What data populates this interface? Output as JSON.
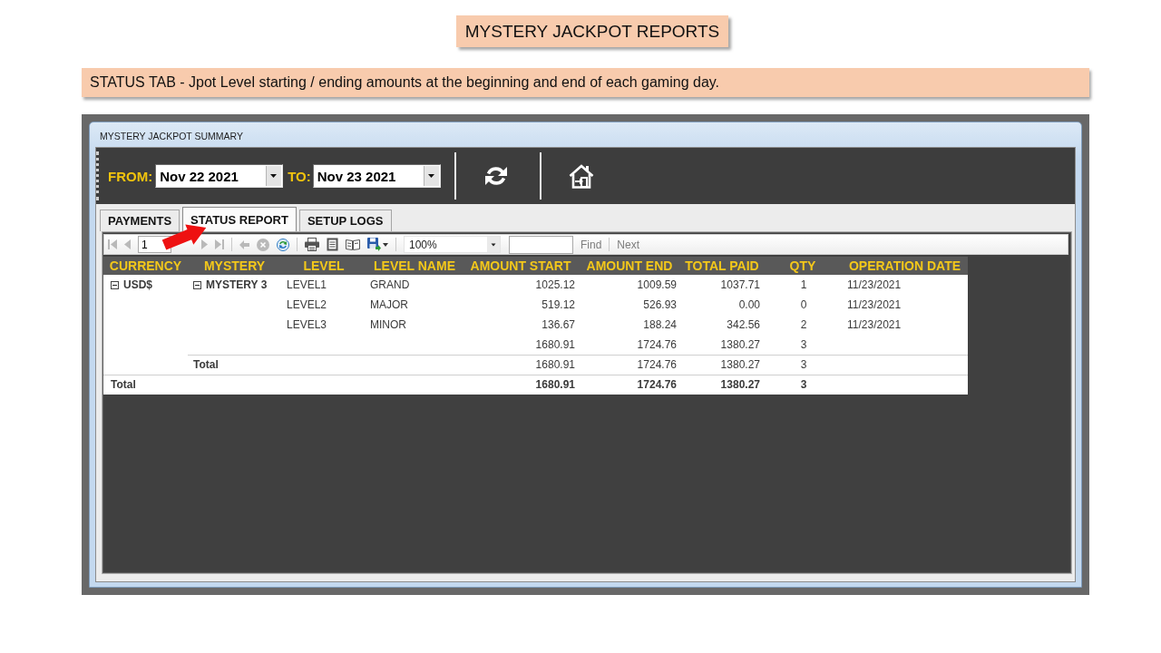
{
  "heading": "MYSTERY JACKPOT REPORTS",
  "note": "STATUS TAB - Jpot Level starting / ending amounts at the beginning and end of each gaming day.",
  "window": {
    "title": "MYSTERY JACKPOT SUMMARY",
    "toolbar": {
      "from_label": "FROM:",
      "from_date": "Nov 22 2021",
      "to_label": "TO:",
      "to_date": "Nov 23 2021"
    },
    "tabs": [
      {
        "label": "PAYMENTS",
        "selected": false
      },
      {
        "label": "STATUS REPORT",
        "selected": true
      },
      {
        "label": "SETUP LOGS",
        "selected": false
      }
    ],
    "report_toolbar": {
      "items": [
        {
          "kind": "first",
          "disabled": true
        },
        {
          "kind": "previous",
          "disabled": true
        },
        {
          "kind": "page",
          "value": "1"
        },
        {
          "kind": "next",
          "disabled": true
        },
        {
          "kind": "last",
          "disabled": true
        },
        {
          "kind": "separator"
        },
        {
          "kind": "back",
          "disabled": true
        },
        {
          "kind": "stop",
          "disabled": true
        },
        {
          "kind": "refresh",
          "disabled": false
        },
        {
          "kind": "separator"
        },
        {
          "kind": "print",
          "disabled": false
        },
        {
          "kind": "print-layout",
          "disabled": false
        },
        {
          "kind": "page-setup",
          "disabled": false
        },
        {
          "kind": "export",
          "disabled": false
        },
        {
          "kind": "separator"
        },
        {
          "kind": "zoom",
          "value": "100%"
        },
        {
          "kind": "find-field"
        },
        {
          "kind": "find",
          "label": "Find",
          "disabled": true
        },
        {
          "kind": "separator"
        },
        {
          "kind": "find-next",
          "label": "Next",
          "disabled": true
        }
      ]
    },
    "table": {
      "columns": [
        "CURRENCY",
        "MYSTERY",
        "LEVEL",
        "LEVEL NAME",
        "AMOUNT START",
        "AMOUNT END",
        "TOTAL PAID",
        "QTY",
        "OPERATION DATE"
      ],
      "groups": [
        {
          "currency": "USD$",
          "expanded": true,
          "mysteries": [
            {
              "name": "MYSTERY 3",
              "expanded": true,
              "rows": [
                {
                  "level": "LEVEL1",
                  "level_name": "GRAND",
                  "amount_start": "1025.12",
                  "amount_end": "1009.59",
                  "total_paid": "1037.71",
                  "qty": "1",
                  "operation_date": "11/23/2021"
                },
                {
                  "level": "LEVEL2",
                  "level_name": "MAJOR",
                  "amount_start": "519.12",
                  "amount_end": "526.93",
                  "total_paid": "0.00",
                  "qty": "0",
                  "operation_date": "11/23/2021"
                },
                {
                  "level": "LEVEL3",
                  "level_name": "MINOR",
                  "amount_start": "136.67",
                  "amount_end": "188.24",
                  "total_paid": "342.56",
                  "qty": "2",
                  "operation_date": "11/23/2021"
                }
              ],
              "subtotal": {
                "amount_start": "1680.91",
                "amount_end": "1724.76",
                "total_paid": "1380.27",
                "qty": "3"
              }
            }
          ],
          "total": {
            "label": "Total",
            "amount_start": "1680.91",
            "amount_end": "1724.76",
            "total_paid": "1380.27",
            "qty": "3"
          }
        }
      ],
      "grand_total": {
        "label": "Total",
        "amount_start": "1680.91",
        "amount_end": "1724.76",
        "total_paid": "1380.27",
        "qty": "3"
      }
    }
  }
}
